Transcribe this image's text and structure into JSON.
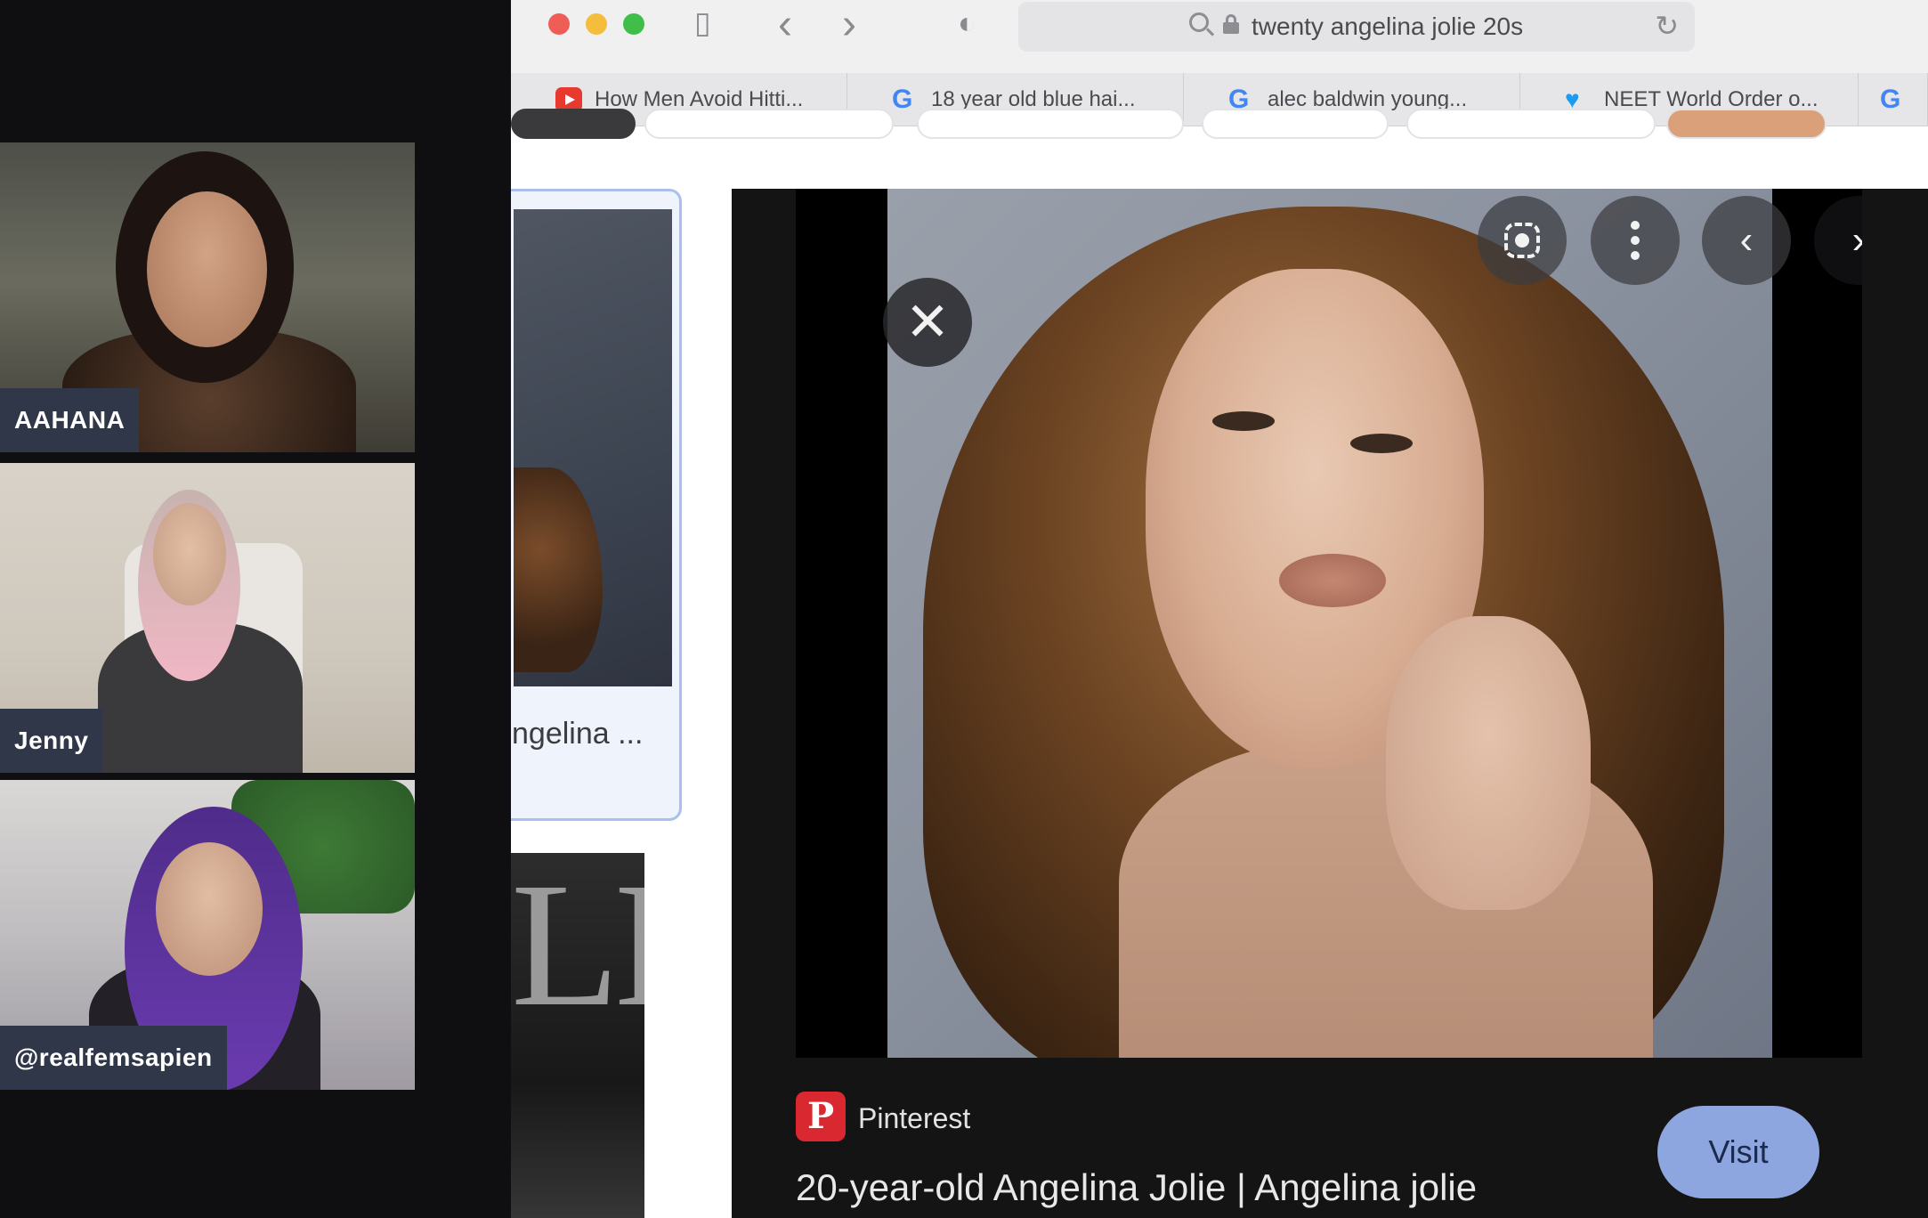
{
  "participants": [
    {
      "name": "AAHANA"
    },
    {
      "name": "Jenny"
    },
    {
      "name": "@realfemsapien"
    }
  ],
  "browser": {
    "address": {
      "url": "twenty angelina jolie 20s"
    },
    "tabs": [
      {
        "label": "How Men Avoid Hitti...",
        "icon": "youtube-icon"
      },
      {
        "label": "18 year old blue hai...",
        "icon": "google-icon"
      },
      {
        "label": "alec baldwin young...",
        "icon": "google-icon"
      },
      {
        "label": "NEET World Order o...",
        "icon": "twitter-icon"
      }
    ],
    "toolbar": {
      "sidebar_glyph": "▯",
      "back_glyph": "‹",
      "forward_glyph": "›",
      "shield_glyph": "◐",
      "reload_glyph": "↻"
    }
  },
  "results": {
    "card_caption": "ngelina ...",
    "magazine_masthead": "LE"
  },
  "viewer": {
    "close_glyph": "✕",
    "prev_glyph": "‹",
    "next_glyph": "›",
    "source": {
      "name": "Pinterest",
      "icon_letter": "P"
    },
    "title": "20-year-old Angelina Jolie | Angelina jolie",
    "visit_label": "Visit"
  },
  "colors": {
    "accent": "#8ea6df",
    "pinterest": "#d9282f",
    "name_tag": "#2f3748"
  }
}
